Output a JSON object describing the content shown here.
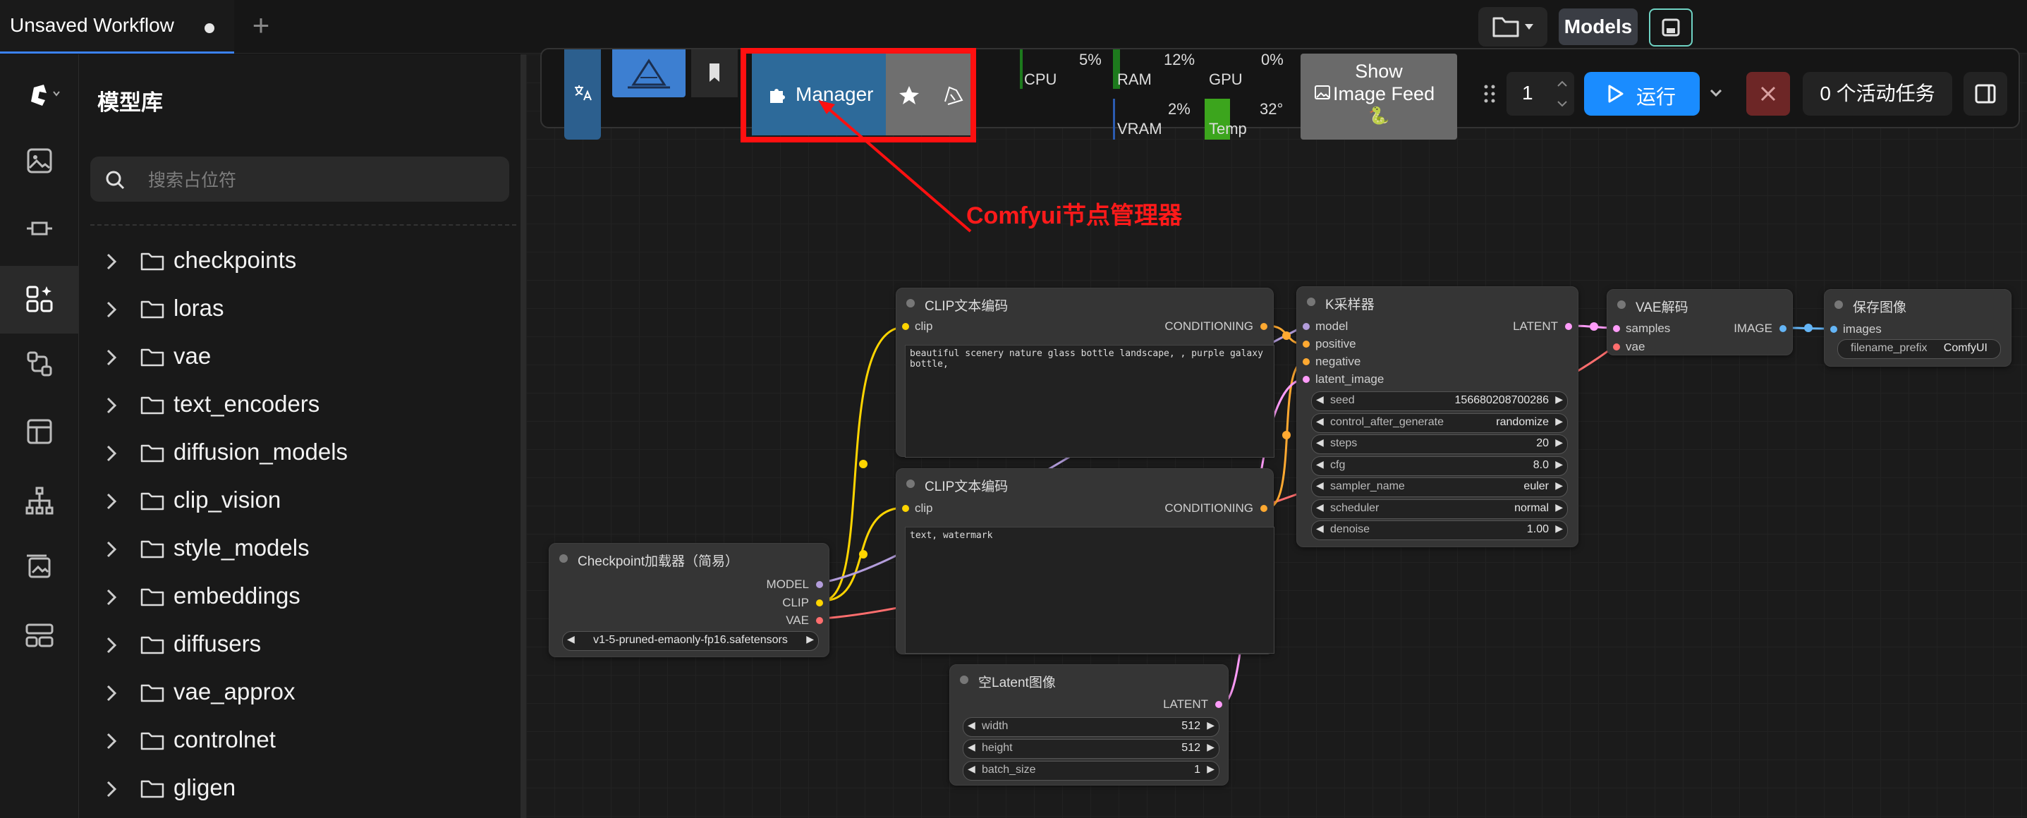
{
  "tab": {
    "title": "Unsaved Workflow",
    "add": "+"
  },
  "topbar": {
    "models_label": "Models"
  },
  "sidebar": {
    "title": "模型库",
    "search_placeholder": "搜索占位符",
    "folders": [
      "checkpoints",
      "loras",
      "vae",
      "text_encoders",
      "diffusion_models",
      "clip_vision",
      "style_models",
      "embeddings",
      "diffusers",
      "vae_approx",
      "controlnet",
      "gligen"
    ]
  },
  "toolbar": {
    "manager_label": "Manager",
    "annotation": "Comfyui节点管理器",
    "stats": {
      "cpu_label": "CPU",
      "cpu_value": "5%",
      "ram_label": "RAM",
      "ram_value": "12%",
      "gpu_label": "GPU",
      "gpu_value": "0%",
      "vram_label": "VRAM",
      "vram_value": "2%",
      "temp_label": "Temp",
      "temp_value": "32°"
    },
    "show_feed_line1": "Show",
    "show_feed_line2": "Image Feed",
    "show_feed_emoji": "🐍",
    "queue_count": "1",
    "run_label": "运行",
    "jobs_label": "0 个活动任务"
  },
  "nodes": {
    "clip_pos": {
      "title": "CLIP文本编码",
      "in": "clip",
      "out": "CONDITIONING",
      "text": "beautiful scenery nature glass bottle landscape, , purple galaxy bottle,"
    },
    "clip_neg": {
      "title": "CLIP文本编码",
      "in": "clip",
      "out": "CONDITIONING",
      "text": "text, watermark"
    },
    "checkpoint": {
      "title": "Checkpoint加载器（简易）",
      "out_model": "MODEL",
      "out_clip": "CLIP",
      "out_vae": "VAE",
      "ckpt": "v1-5-pruned-emaonly-fp16.safetensors"
    },
    "latent": {
      "title": "空Latent图像",
      "out": "LATENT",
      "widgets": [
        {
          "label": "width",
          "value": "512"
        },
        {
          "label": "height",
          "value": "512"
        },
        {
          "label": "batch_size",
          "value": "1"
        }
      ]
    },
    "ksampler": {
      "title": "K采样器",
      "inputs": [
        "model",
        "positive",
        "negative",
        "latent_image"
      ],
      "out": "LATENT",
      "widgets": [
        {
          "label": "seed",
          "value": "156680208700286"
        },
        {
          "label": "control_after_generate",
          "value": "randomize"
        },
        {
          "label": "steps",
          "value": "20"
        },
        {
          "label": "cfg",
          "value": "8.0"
        },
        {
          "label": "sampler_name",
          "value": "euler"
        },
        {
          "label": "scheduler",
          "value": "normal"
        },
        {
          "label": "denoise",
          "value": "1.00"
        }
      ]
    },
    "vae_decode": {
      "title": "VAE解码",
      "in_samples": "samples",
      "in_vae": "vae",
      "out": "IMAGE"
    },
    "save_image": {
      "title": "保存图像",
      "in": "images",
      "prefix_label": "filename_prefix",
      "prefix_value": "ComfyUI"
    }
  },
  "colors": {
    "accent": "#1a8cff",
    "highlight": "#ff1010",
    "clip": "#ffd500",
    "model": "#b39ddb",
    "vae": "#ff6e6e",
    "latent": "#ff9cf9",
    "conditioning": "#ffa931"
  }
}
